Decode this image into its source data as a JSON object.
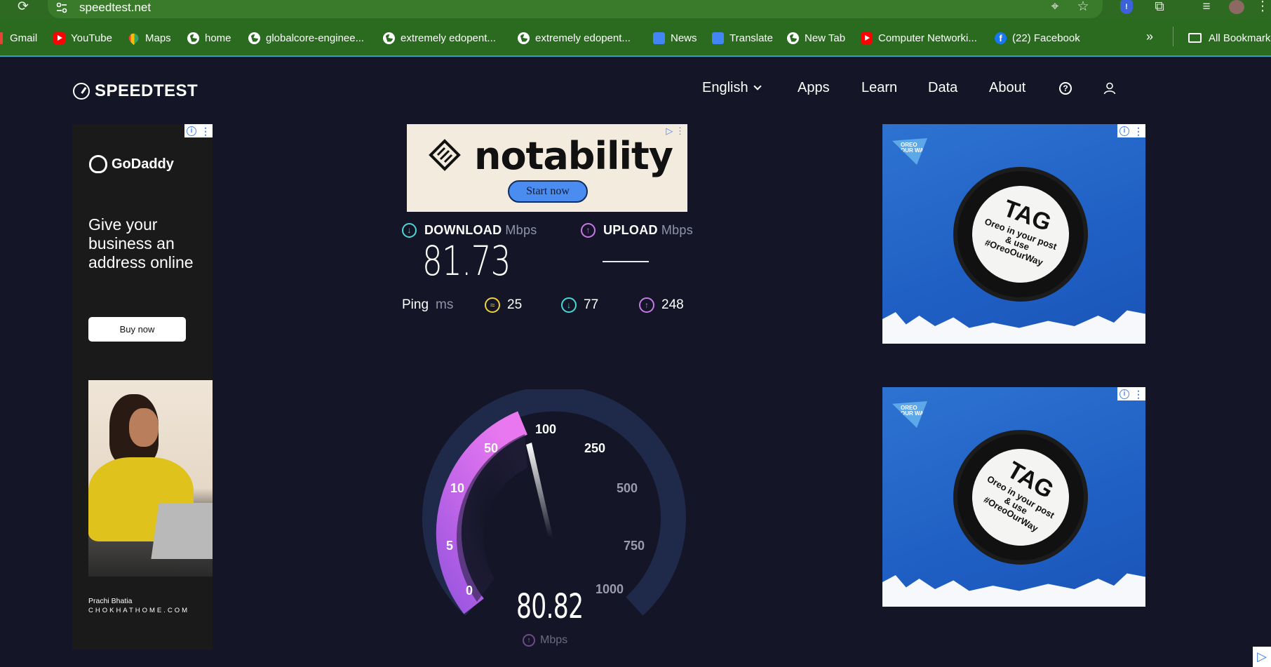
{
  "browser": {
    "url": "speedtest.net",
    "bookmarks": [
      {
        "label": "Gmail",
        "icon": "gmail-icon"
      },
      {
        "label": "YouTube",
        "icon": "youtube-icon"
      },
      {
        "label": "Maps",
        "icon": "maps-icon"
      },
      {
        "label": "home",
        "icon": "globe-icon"
      },
      {
        "label": "globalcore-enginee...",
        "icon": "globe-icon"
      },
      {
        "label": "extremely edopent...",
        "icon": "globe-icon"
      },
      {
        "label": "extremely edopent...",
        "icon": "globe-icon"
      },
      {
        "label": "News",
        "icon": "news-icon"
      },
      {
        "label": "Translate",
        "icon": "translate-icon"
      },
      {
        "label": "New Tab",
        "icon": "globe-icon"
      },
      {
        "label": "Computer Networki...",
        "icon": "youtube-icon"
      },
      {
        "label": "(22) Facebook",
        "icon": "facebook-icon"
      }
    ],
    "more_label": "»",
    "all_bookmarks": "All Bookmarks"
  },
  "site": {
    "logo": "SPEEDTEST",
    "nav": {
      "language": "English",
      "apps": "Apps",
      "learn": "Learn",
      "data": "Data",
      "about": "About"
    }
  },
  "ads": {
    "godaddy": {
      "brand": "GoDaddy",
      "headline": "Give your business an address online",
      "cta": "Buy now",
      "credit_name": "Prachi Bhatia",
      "credit_site": "CHOKHATHOME.COM"
    },
    "notability": {
      "brand": "notability",
      "cta": "Start now"
    },
    "oreo": {
      "brand": "OREO OUR WAY",
      "tag": "TAG",
      "text": "Oreo in your post & use #OreoOurWay"
    }
  },
  "results": {
    "download_label": "DOWNLOAD",
    "download_unit": "Mbps",
    "download_value": "81.73",
    "upload_label": "UPLOAD",
    "upload_unit": "Mbps",
    "ping_label": "Ping",
    "ping_unit": "ms",
    "ping_idle": "25",
    "ping_download": "77",
    "ping_upload": "248"
  },
  "gauge": {
    "ticks": [
      "0",
      "5",
      "10",
      "50",
      "100",
      "250",
      "500",
      "750",
      "1000"
    ],
    "current_value": "80.82",
    "unit": "Mbps",
    "colors": {
      "progress_start": "#9a55e0",
      "progress_end": "#e877f0",
      "track": "#1f2a4a"
    }
  }
}
